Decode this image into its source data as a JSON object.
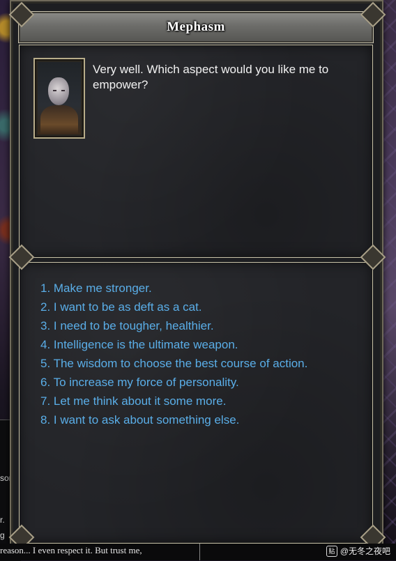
{
  "dialog": {
    "speaker_name": "Mephasm",
    "npc_line": "Very well. Which aspect would you like me to empower?",
    "options": [
      "1. Make me stronger.",
      "2. I want to be as deft as a cat.",
      "3. I need to be tougher, healthier.",
      "4. Intelligence is the ultimate weapon.",
      "5. The wisdom to choose the best course of action.",
      "6. To increase my force of personality.",
      "7. Let me think about it some more.",
      "8. I want to ask about something else."
    ]
  },
  "chat_log": {
    "snippet_1": "son",
    "snippet_2": "r.",
    "snippet_3": "g",
    "bottom_line": "reason... I even respect it. But trust me,"
  },
  "watermark": {
    "text": "@无冬之夜吧",
    "icon_glyph": "贴"
  },
  "colors": {
    "option_text": "#5aaee8",
    "npc_text": "#f2f2f2",
    "panel_border": "#c8c2a8"
  }
}
